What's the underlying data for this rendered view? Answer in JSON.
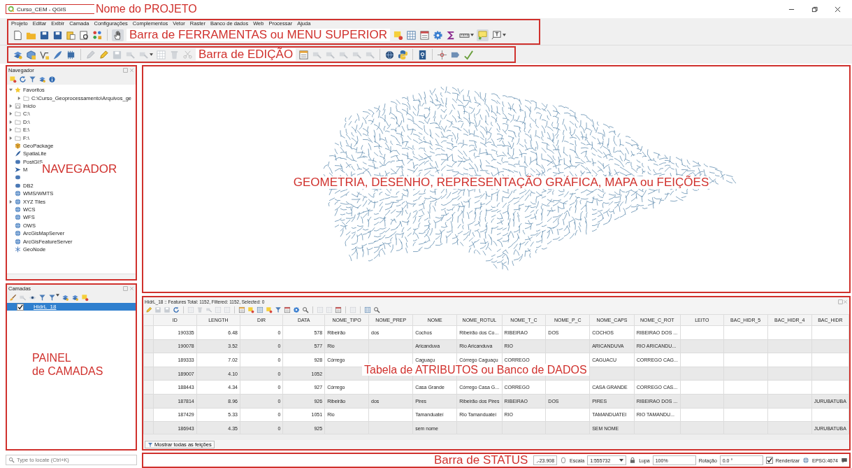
{
  "window": {
    "title": "Curso_CEM - QGIS"
  },
  "annotations": {
    "title": "Nome do PROJETO",
    "toolbar": "Barra de FERRAMENTAS ou MENU SUPERIOR",
    "edit_toolbar": "Barra de EDIÇÃO",
    "navigator": "NAVEGADOR",
    "map": "GEOMETRIA, DESENHO, REPRESENTAÇÃO GRÁFICA, MAPA ou FEIÇÕES",
    "layers": [
      "PAINEL",
      "de CAMADAS"
    ],
    "table": "Tabela de ATRIBUTOS ou Banco de DADOS",
    "status": "Barra de STATUS"
  },
  "menu": [
    "Projeto",
    "Editar",
    "Exibir",
    "Camada",
    "Configurações",
    "Complementos",
    "Vetor",
    "Raster",
    "Banco de dados",
    "Web",
    "Processar",
    "Ajuda"
  ],
  "navigator": {
    "title": "Navegador",
    "items": [
      {
        "kind": "star",
        "label": "Favoritos",
        "expanded": true,
        "children": [
          {
            "kind": "folder",
            "label": "C:\\Curso_Geoprocessamento\\Arquivos_ge",
            "expanded": false
          }
        ]
      },
      {
        "kind": "home",
        "label": "Início",
        "expanded": false
      },
      {
        "kind": "folder",
        "label": "C:\\",
        "expanded": false
      },
      {
        "kind": "folder",
        "label": "D:\\",
        "expanded": false
      },
      {
        "kind": "folder",
        "label": "E:\\",
        "expanded": false
      },
      {
        "kind": "folder",
        "label": "F:\\",
        "expanded": false
      },
      {
        "kind": "package",
        "label": "GeoPackage"
      },
      {
        "kind": "feather",
        "label": "SpatiaLite"
      },
      {
        "kind": "database",
        "label": "PostGIS"
      },
      {
        "kind": "arrow",
        "label": "M"
      },
      {
        "kind": "database"
      },
      {
        "kind": "database",
        "label": "DB2"
      },
      {
        "kind": "globe",
        "label": "WMS/WMTS"
      },
      {
        "kind": "globe",
        "label": "XYZ Tiles",
        "expanded": false
      },
      {
        "kind": "globe",
        "label": "WCS"
      },
      {
        "kind": "globe",
        "label": "WFS"
      },
      {
        "kind": "globe",
        "label": "OWS"
      },
      {
        "kind": "globe",
        "label": "ArcGisMapServer"
      },
      {
        "kind": "globe",
        "label": "ArcGisFeatureServer"
      },
      {
        "kind": "snowflake",
        "label": "GeoNode"
      }
    ]
  },
  "layers": {
    "title": "Camadas",
    "items": [
      {
        "label": "HidrL_18",
        "checked": true,
        "selected": true
      }
    ]
  },
  "locator": {
    "placeholder": "Type to locate (Ctrl+K)"
  },
  "attribute_table": {
    "title": "HidrL_18 :: Features Total: 1152, Filtered: 1152, Selected: 0",
    "columns": [
      "ID",
      "LENGTH",
      "DIR",
      "DATA",
      "NOME_TIPO",
      "NOME_PREP",
      "NOME",
      "NOME_ROTUL",
      "NOME_T_C",
      "NOME_P_C",
      "NOME_CAPS",
      "NOME_C_ROT",
      "LEITO",
      "BAC_HIDR_5",
      "BAC_HIDR_4",
      "BAC_HIDR"
    ],
    "rows": [
      [
        "190335",
        "6.48",
        "0",
        "578",
        "Ribeirão",
        "dos",
        "Cochos",
        "Ribeirão dos Co...",
        "RIBEIRAO",
        "DOS",
        "COCHOS",
        "RIBEIRAO DOS ...",
        null,
        null,
        null,
        null
      ],
      [
        "190078",
        "3.52",
        "0",
        "577",
        "Rio",
        null,
        "Aricanduva",
        "Rio Aricanduva",
        "RIO",
        null,
        "ARICANDUVA",
        "RIO ARICANDU...",
        null,
        null,
        null,
        null
      ],
      [
        "189333",
        "7.02",
        "0",
        "928",
        "Córrego",
        null,
        "Caguaçu",
        "Córrego Caguaçu",
        "CORREGO",
        null,
        "CAGUACU",
        "CORREGO CAG...",
        null,
        null,
        null,
        null
      ],
      [
        "189007",
        "4.10",
        "0",
        "1052",
        null,
        null,
        null,
        null,
        null,
        null,
        null,
        null,
        null,
        null,
        null,
        null
      ],
      [
        "188443",
        "4.34",
        "0",
        "927",
        "Córrego",
        null,
        "Casa Grande",
        "Córrego Casa G...",
        "CORREGO",
        null,
        "CASA GRANDE",
        "CORREGO CAS...",
        null,
        null,
        null,
        null
      ],
      [
        "187814",
        "8.96",
        "0",
        "926",
        "Ribeirão",
        "dos",
        "Pires",
        "Ribeirão dos Pires",
        "RIBEIRAO",
        "DOS",
        "PIRES",
        "RIBEIRAO DOS ...",
        null,
        null,
        null,
        "JURUBATUBA"
      ],
      [
        "187429",
        "5.33",
        "0",
        "1051",
        "Rio",
        null,
        "Tamanduateí",
        "Rio Tamanduateí",
        "RIO",
        null,
        "TAMANDUATEI",
        "RIO TAMANDU...",
        null,
        null,
        null,
        null
      ],
      [
        "186943",
        "4.35",
        "0",
        "925",
        null,
        null,
        "sem nome",
        null,
        null,
        null,
        "SEM NOME",
        null,
        null,
        null,
        null,
        "JURUBATUBA"
      ]
    ],
    "filter_button": "Mostrar todas as feições"
  },
  "status_bar": {
    "coordinate": ",-23.908",
    "scale_label": "Escala",
    "scale": "1:555732",
    "magnifier_label": "Lupa",
    "magnifier": "100%",
    "rotation_label": "Rotação",
    "rotation": "0.0 °",
    "render": {
      "label": "Renderizar",
      "checked": true
    },
    "crs": "EPSG:4674"
  }
}
